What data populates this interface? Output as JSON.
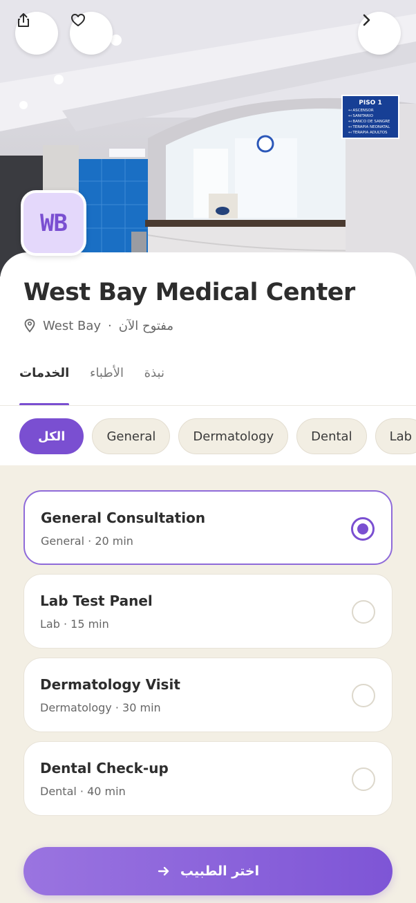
{
  "header": {
    "share_icon": "share-icon",
    "favorite_icon": "heart-icon",
    "next_icon": "chevron-right-icon"
  },
  "clinic": {
    "logo_text": "WB",
    "name": "West Bay Medical Center",
    "location": "West Bay",
    "status": "مفتوح الآن",
    "separator": "·"
  },
  "photo_sign": {
    "title": "PISO 1",
    "lines": [
      "ASCENSOR",
      "SANITARIO",
      "BANCO DE SANGRE",
      "TERAPIA NEONATAL",
      "TERAPIA ADULTOS"
    ]
  },
  "tabs": [
    {
      "label": "الخدمات",
      "active": true
    },
    {
      "label": "الأطباء",
      "active": false
    },
    {
      "label": "نبذة",
      "active": false
    }
  ],
  "filters": [
    {
      "label": "الكل",
      "active": true
    },
    {
      "label": "General",
      "active": false
    },
    {
      "label": "Dermatology",
      "active": false
    },
    {
      "label": "Dental",
      "active": false
    },
    {
      "label": "Lab",
      "active": false
    }
  ],
  "services": [
    {
      "title": "General Consultation",
      "subtitle": "General · 20 min",
      "selected": true
    },
    {
      "title": "Lab Test Panel",
      "subtitle": "Lab · 15 min",
      "selected": false
    },
    {
      "title": "Dermatology Visit",
      "subtitle": "Dermatology · 30 min",
      "selected": false
    },
    {
      "title": "Dental Check-up",
      "subtitle": "Dental · 40 min",
      "selected": false
    }
  ],
  "cta": {
    "label": "اختر الطبيب",
    "icon": "arrow-right-icon"
  },
  "colors": {
    "accent": "#7a4fd1",
    "background": "#f3efe4"
  }
}
